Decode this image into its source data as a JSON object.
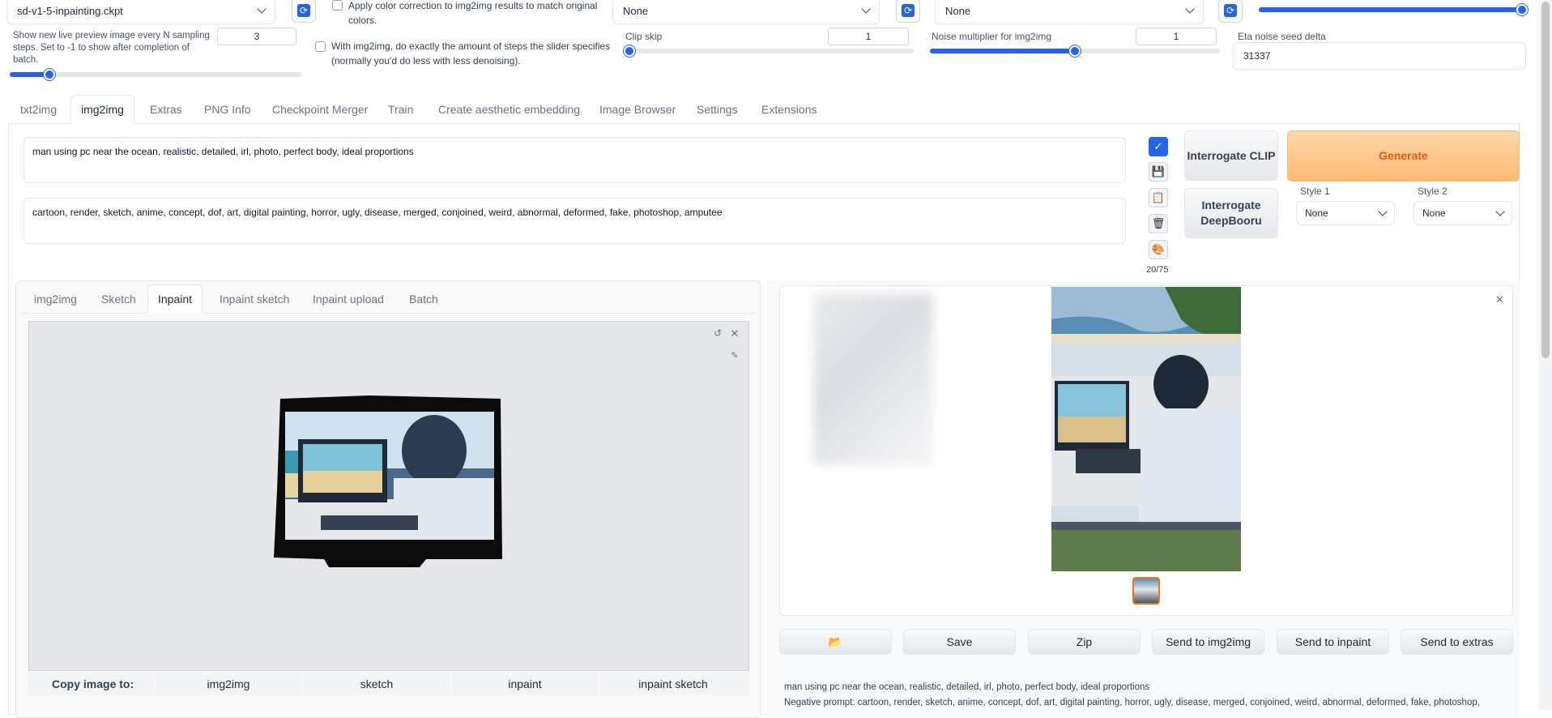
{
  "settings": {
    "checkpoint": "sd-v1-5-inpainting.ckpt",
    "color_correction_label": "Apply color correction to img2img results to match original colors.",
    "hypernetwork_value": "None",
    "vae_value": "None",
    "live_preview_label": "Show new live preview image every N sampling steps. Set to -1 to show after completion of batch.",
    "live_preview_value": "3",
    "exact_steps_label": "With img2img, do exactly the amount of steps the slider specifies (normally you'd do less with less denoising).",
    "clip_skip_label": "Clip skip",
    "clip_skip_value": "1",
    "noise_mult_label": "Noise multiplier for img2img",
    "noise_mult_value": "1",
    "eta_label": "Eta noise seed delta",
    "eta_value": "31337"
  },
  "main_tabs": [
    "txt2img",
    "img2img",
    "Extras",
    "PNG Info",
    "Checkpoint Merger",
    "Train",
    "Create aesthetic embedding",
    "Image Browser",
    "Settings",
    "Extensions"
  ],
  "prompt": {
    "positive": "man using pc near the ocean, realistic, detailed, irl, photo, perfect body, ideal proportions",
    "negative": "cartoon, render, sketch, anime, concept, dof, art, digital painting, horror, ugly, disease, merged, conjoined, weird, abnormal, deformed, fake, photoshop, amputee",
    "token_count": "20/75"
  },
  "buttons": {
    "interrogate_clip": "Interrogate CLIP",
    "interrogate_deepbooru": "Interrogate DeepBooru",
    "generate": "Generate"
  },
  "styles": {
    "style1_label": "Style 1",
    "style1_value": "None",
    "style2_label": "Style 2",
    "style2_value": "None"
  },
  "sub_tabs": [
    "img2img",
    "Sketch",
    "Inpaint",
    "Inpaint sketch",
    "Inpaint upload",
    "Batch"
  ],
  "copy_image": {
    "label": "Copy image to:",
    "targets": [
      "img2img",
      "sketch",
      "inpaint",
      "inpaint sketch"
    ]
  },
  "output_actions": [
    "Save",
    "Zip",
    "Send to img2img",
    "Send to inpaint",
    "Send to extras"
  ],
  "output_info": {
    "prompt_line": "man using pc near the ocean, realistic, detailed, irl, photo, perfect body, ideal proportions",
    "negative_line": "Negative prompt: cartoon, render, sketch, anime, concept, dof, art, digital painting, horror, ugly, disease, merged, conjoined, weird, abnormal, deformed, fake, photoshop,"
  },
  "colors": {
    "accent": "#2563eb",
    "generate_bg": "#fdba74",
    "generate_text": "#ea580c"
  }
}
